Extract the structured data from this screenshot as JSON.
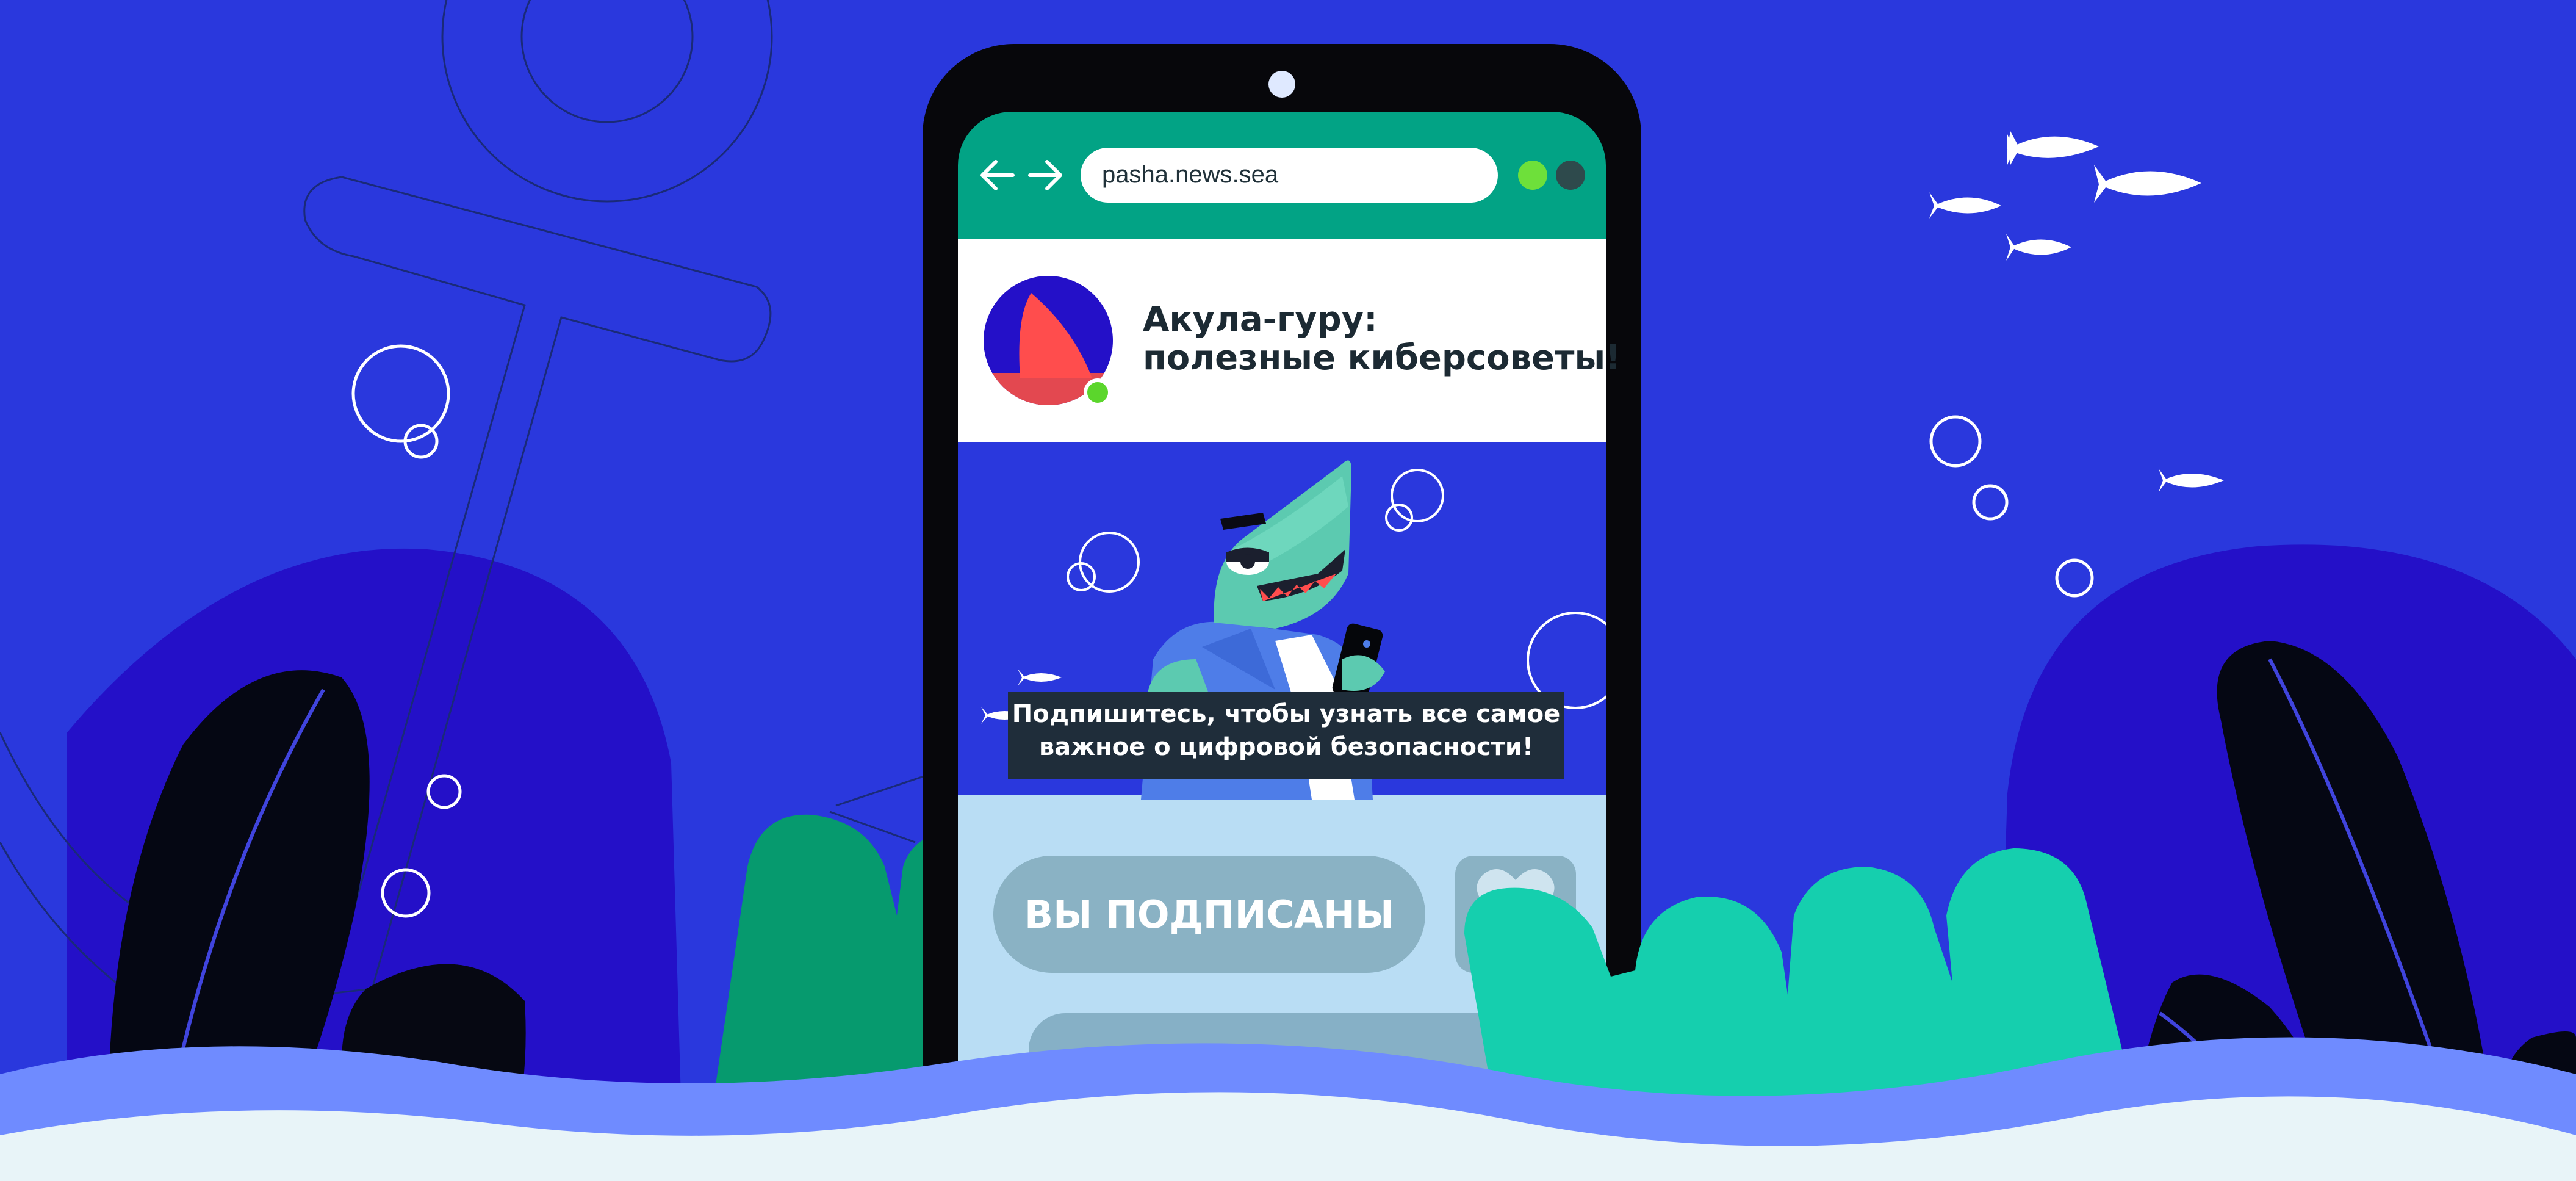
{
  "browser": {
    "url": "pasha.news.sea",
    "back_icon": "arrow-left-icon",
    "forward_icon": "arrow-right-icon",
    "status_colors": [
      "#6ee03a",
      "#2e4a4c"
    ]
  },
  "channel": {
    "title_line1": "Акула-гуру:",
    "title_line2": "полезные киберсоветы!",
    "online_color": "#5bd62c"
  },
  "banner": {
    "caption_line1": "Подпишитесь, чтобы узнать все самое",
    "caption_line2": "важное о цифровой безопасности!"
  },
  "actions": {
    "subscribed_label": "ВЫ ПОДПИСАНЫ",
    "like_icon": "heart-icon"
  },
  "colors": {
    "background": "#2a38dd",
    "browser_bar": "#02a385",
    "hand": "#15cfae",
    "accent_red": "#ff4d4d"
  }
}
